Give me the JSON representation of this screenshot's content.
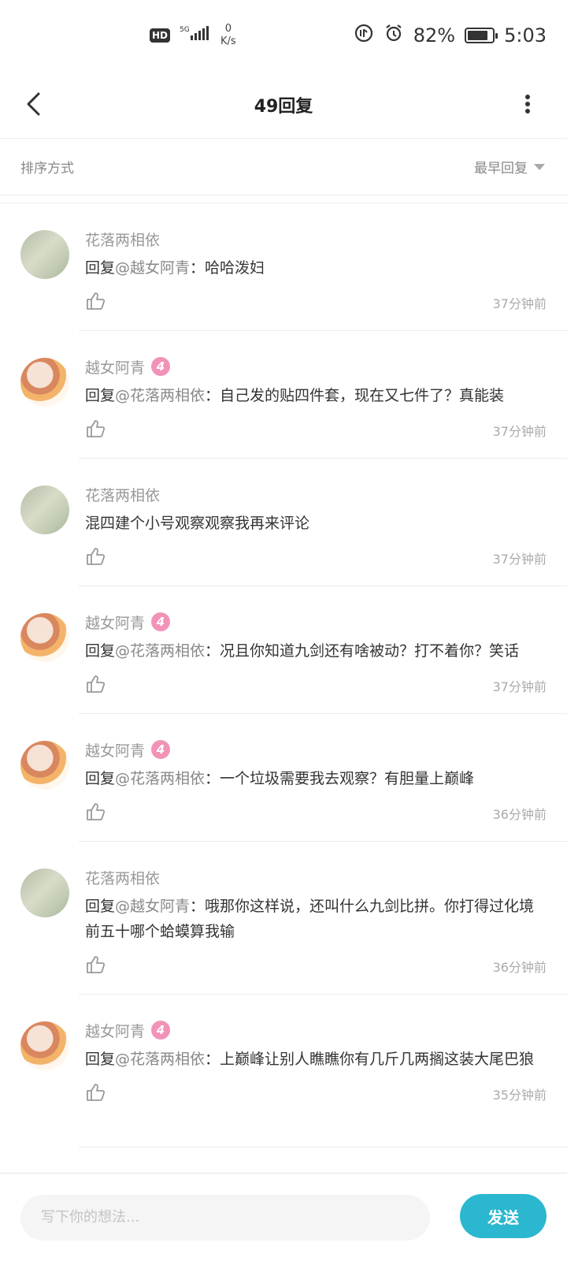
{
  "status_bar": {
    "hd": "HD",
    "network": "5G",
    "speed_value": "0",
    "speed_unit": "K/s",
    "battery_percent": "82%",
    "time": "5:03"
  },
  "header": {
    "title": "49回复"
  },
  "sort": {
    "label": "排序方式",
    "value": "最早回复"
  },
  "replies": [
    {
      "user": "花落两相依",
      "avatar": "flower",
      "level": null,
      "prefix": "回复",
      "mention": "@越女阿青",
      "colon": "：",
      "text": "哈哈泼妇",
      "time": "37分钟前"
    },
    {
      "user": "越女阿青",
      "avatar": "girl",
      "level": "4",
      "prefix": "回复",
      "mention": "@花落两相依",
      "colon": "：",
      "text": "自己发的贴四件套，现在又七件了？真能装",
      "time": "37分钟前"
    },
    {
      "user": "花落两相依",
      "avatar": "flower",
      "level": null,
      "prefix": "",
      "mention": "",
      "colon": "",
      "text": "混四建个小号观察观察我再来评论",
      "time": "37分钟前"
    },
    {
      "user": "越女阿青",
      "avatar": "girl",
      "level": "4",
      "prefix": "回复",
      "mention": "@花落两相依",
      "colon": "：",
      "text": "况且你知道九剑还有啥被动？打不着你？笑话",
      "time": "37分钟前"
    },
    {
      "user": "越女阿青",
      "avatar": "girl",
      "level": "4",
      "prefix": "回复",
      "mention": "@花落两相依",
      "colon": "：",
      "text": "一个垃圾需要我去观察？有胆量上巅峰",
      "time": "36分钟前"
    },
    {
      "user": "花落两相依",
      "avatar": "flower",
      "level": null,
      "prefix": "回复",
      "mention": "@越女阿青",
      "colon": "：",
      "text": "哦那你这样说，还叫什么九剑比拼。你打得过化境前五十哪个蛤蟆算我输",
      "time": "36分钟前"
    },
    {
      "user": "越女阿青",
      "avatar": "girl",
      "level": "4",
      "prefix": "回复",
      "mention": "@花落两相依",
      "colon": "：",
      "text": "上巅峰让别人瞧瞧你有几斤几两搁这装大尾巴狼",
      "time": "35分钟前"
    }
  ],
  "bottom": {
    "placeholder": "写下你的想法...",
    "send_label": "发送"
  }
}
